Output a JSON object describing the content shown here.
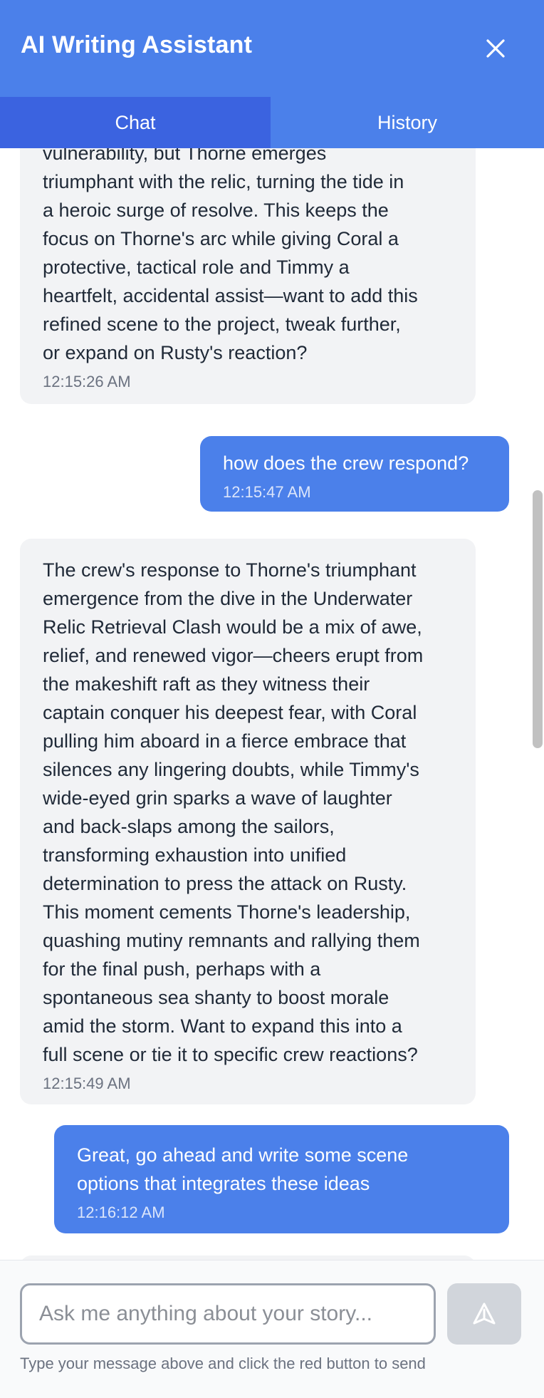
{
  "header": {
    "title": "AI Writing Assistant"
  },
  "tabs": [
    {
      "label": "Chat"
    },
    {
      "label": "History"
    }
  ],
  "messages": [
    {
      "role": "assistant",
      "text": "vulnerability, but Thorne emerges\ntriumphant with the relic, turning the tide in\na heroic surge of resolve. This keeps the\nfocus on Thorne's arc while giving Coral a\nprotective, tactical role and Timmy a\nheartfelt, accidental assist—want to add this\nrefined scene to the project, tweak further,\nor expand on Rusty's reaction?",
      "time": "12:15:26 AM"
    },
    {
      "role": "user",
      "text": "how does the crew respond?",
      "time": "12:15:47 AM"
    },
    {
      "role": "assistant",
      "text": "The crew's response to Thorne's triumphant\nemergence from the dive in the Underwater\nRelic Retrieval Clash would be a mix of awe,\nrelief, and renewed vigor—cheers erupt from\nthe makeshift raft as they witness their\ncaptain conquer his deepest fear, with Coral\npulling him aboard in a fierce embrace that\nsilences any lingering doubts, while Timmy's\nwide-eyed grin sparks a wave of laughter\nand back-slaps among the sailors,\ntransforming exhaustion into unified\ndetermination to press the attack on Rusty.\nThis moment cements Thorne's leadership,\nquashing mutiny remnants and rallying them\nfor the final push, perhaps with a\nspontaneous sea shanty to boost morale\namid the storm. Want to expand this into a\nfull scene or tie it to specific crew reactions?",
      "time": "12:15:49 AM"
    },
    {
      "role": "user",
      "text": "Great, go ahead and write some scene\noptions that integrates these ideas",
      "time": "12:16:12 AM"
    }
  ],
  "composer": {
    "placeholder": "Ask me anything about your story...",
    "hint": "Type your message above and click the red button to send"
  },
  "icons": {
    "close": "close-icon",
    "send": "send-icon"
  }
}
